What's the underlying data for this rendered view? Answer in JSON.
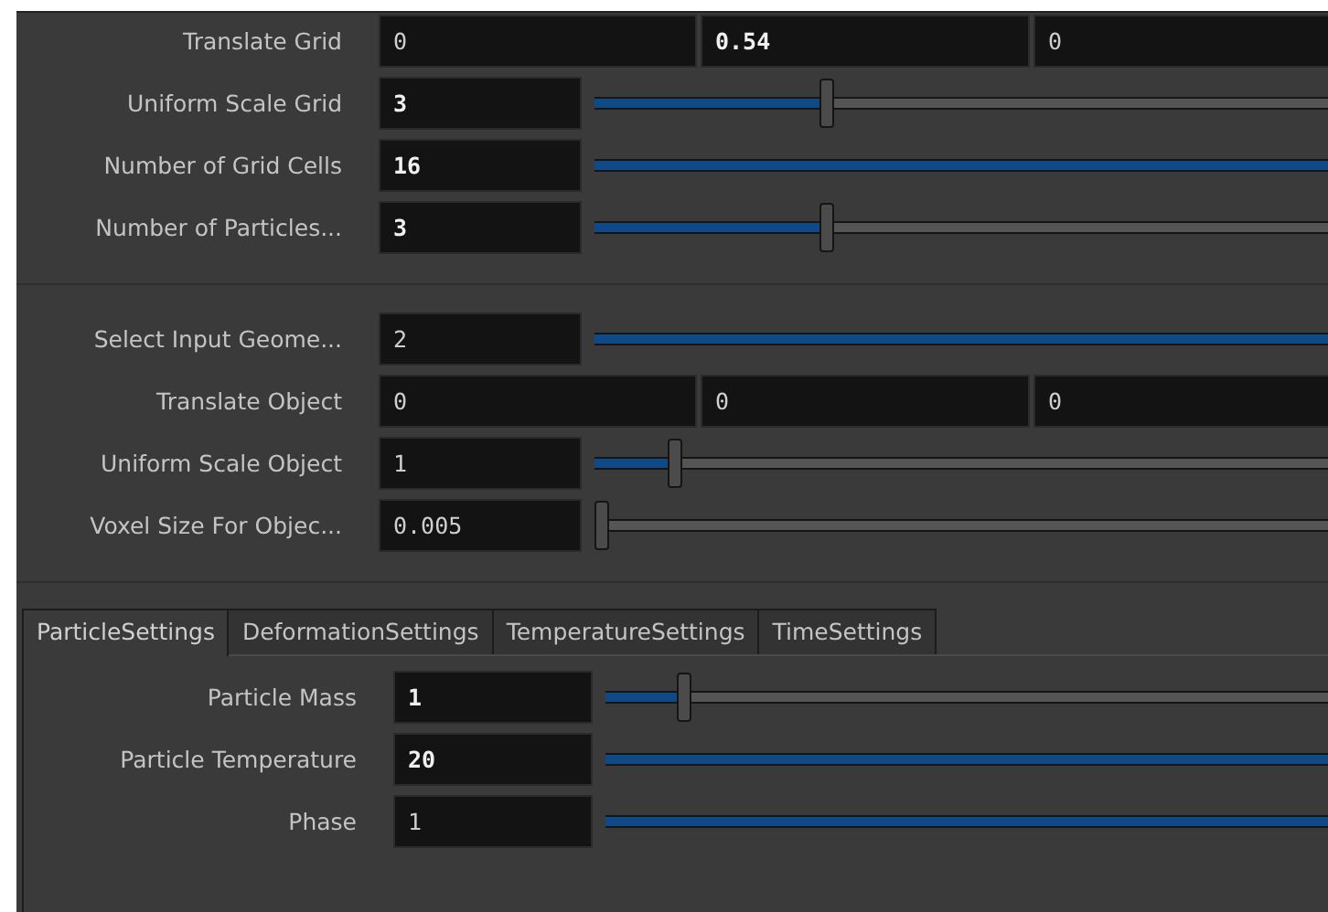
{
  "sections": [
    {
      "rows": [
        {
          "kind": "vector",
          "label": "Translate Grid",
          "values": [
            {
              "text": "0",
              "modified": false
            },
            {
              "text": "0.54",
              "modified": true
            },
            {
              "text": "0",
              "modified": false
            }
          ]
        },
        {
          "kind": "slider",
          "label": "Uniform Scale Grid",
          "value": "3",
          "modified": true,
          "level": 0.31
        },
        {
          "kind": "slider",
          "label": "Number of Grid Cells",
          "value": "16",
          "modified": true,
          "level": 1
        },
        {
          "kind": "slider",
          "label": "Number of Particles...",
          "value": "3",
          "modified": true,
          "level": 0.31
        }
      ]
    },
    {
      "rows": [
        {
          "kind": "slider",
          "label": "Select Input Geome...",
          "value": "2",
          "modified": false,
          "level": 1
        },
        {
          "kind": "vector",
          "label": "Translate Object",
          "values": [
            {
              "text": "0",
              "modified": false
            },
            {
              "text": "0",
              "modified": false
            },
            {
              "text": "0",
              "modified": false
            }
          ]
        },
        {
          "kind": "slider",
          "label": "Uniform Scale Object",
          "value": "1",
          "modified": false,
          "level": 0.1
        },
        {
          "kind": "slider",
          "label": "Voxel Size For Objec...",
          "value": "0.005",
          "modified": false,
          "level": 0
        }
      ]
    }
  ],
  "tabs": [
    {
      "label": "ParticleSettings",
      "selected": true
    },
    {
      "label": "DeformationSettings",
      "selected": false
    },
    {
      "label": "TemperatureSettings",
      "selected": false
    },
    {
      "label": "TimeSettings",
      "selected": false
    }
  ],
  "tab_rows": [
    {
      "kind": "slider",
      "label": "Particle Mass",
      "value": "1",
      "modified": true,
      "level": 0.1
    },
    {
      "kind": "slider",
      "label": "Particle Temperature",
      "value": "20",
      "modified": true,
      "level": 1
    },
    {
      "kind": "slider",
      "label": "Phase",
      "value": "1",
      "modified": false,
      "level": 1
    }
  ]
}
